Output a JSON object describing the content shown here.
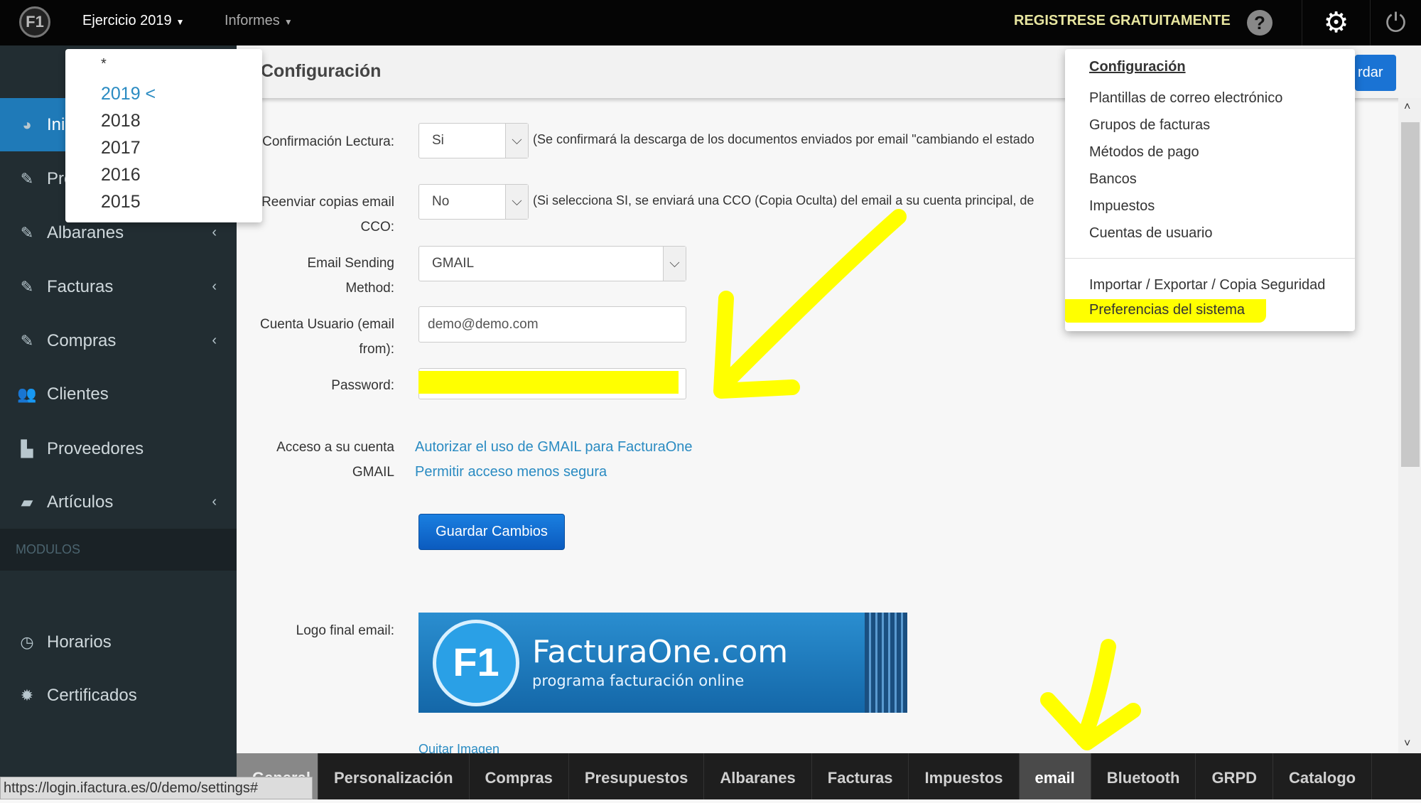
{
  "topbar": {
    "logo": "F1",
    "ejercicio": "Ejercicio 2019",
    "informes": "Informes",
    "register": "REGISTRESE GRATUITAMENTE"
  },
  "year_menu": {
    "items": [
      "*",
      "2019 <",
      "2018",
      "2017",
      "2016",
      "2015"
    ],
    "selected": "2019 <"
  },
  "sidebar": {
    "items": [
      {
        "label": "Inicio",
        "icon": "dashboard-icon",
        "active": true
      },
      {
        "label": "Presupuestos",
        "icon": "edit-icon"
      },
      {
        "label": "Albaranes",
        "icon": "edit-icon",
        "chevron": true
      },
      {
        "label": "Facturas",
        "icon": "edit-icon",
        "chevron": true
      },
      {
        "label": "Compras",
        "icon": "edit-icon",
        "chevron": true
      },
      {
        "label": "Clientes",
        "icon": "users-icon"
      },
      {
        "label": "Proveedores",
        "icon": "industry-icon"
      },
      {
        "label": "Artículos",
        "icon": "shopping-bag-icon",
        "chevron": true
      }
    ],
    "modules_header": "MODULOS",
    "modules": [
      {
        "label": "Horarios",
        "icon": "clock-icon"
      },
      {
        "label": "Certificados",
        "icon": "certificate-icon"
      }
    ]
  },
  "header": {
    "title": "Configuración",
    "save_partial": "rdar"
  },
  "form": {
    "confirm_label": "Confirmación Lectura:",
    "confirm_value": "Si",
    "confirm_hint": "(Se confirmará la descarga de los documentos enviados por email \"cambiando el estado",
    "cc_label": "Reenviar copias email CCO:",
    "cc_value": "No",
    "cc_hint": "(Si selecciona SI, se enviará una CCO (Copia Oculta) del email a su cuenta principal, de",
    "method_label": "Email Sending Method:",
    "method_value": "GMAIL",
    "user_label": "Cuenta Usuario (email from):",
    "user_value": "demo@demo.com",
    "password_label": "Password:",
    "password_value": "",
    "access_label": "Acceso a su cuenta GMAIL",
    "link_authorize": "Autorizar el uso de GMAIL para FacturaOne",
    "link_less_secure": "Permitir acceso menos segura",
    "save_button": "Guardar Cambios",
    "logo_label": "Logo final email:",
    "logo_brand": "FacturaOne.com",
    "logo_tagline": "programa facturación online",
    "logo_mark": "F1",
    "remove_image": "Quitar Imagen"
  },
  "config_menu": {
    "title": "Configuración",
    "items": [
      "Plantillas de correo electrónico",
      "Grupos de facturas",
      "Métodos de pago",
      "Bancos",
      "Impuestos",
      "Cuentas de usuario"
    ],
    "items2": [
      "Importar / Exportar / Copia Seguridad",
      "Preferencias del sistema"
    ],
    "highlighted": "Preferencias del sistema"
  },
  "tabs": {
    "items": [
      "General",
      "Personalización",
      "Compras",
      "Presupuestos",
      "Albaranes",
      "Facturas",
      "Impuestos",
      "email",
      "Bluetooth",
      "GRPD",
      "Catalogo"
    ],
    "active": "email"
  },
  "status_url": "https://login.ifactura.es/0/demo/settings#",
  "colors": {
    "accent": "#1f7ab8",
    "annotation": "#ffff00",
    "sidebar": "#222d32",
    "link": "#2a8bc2"
  }
}
